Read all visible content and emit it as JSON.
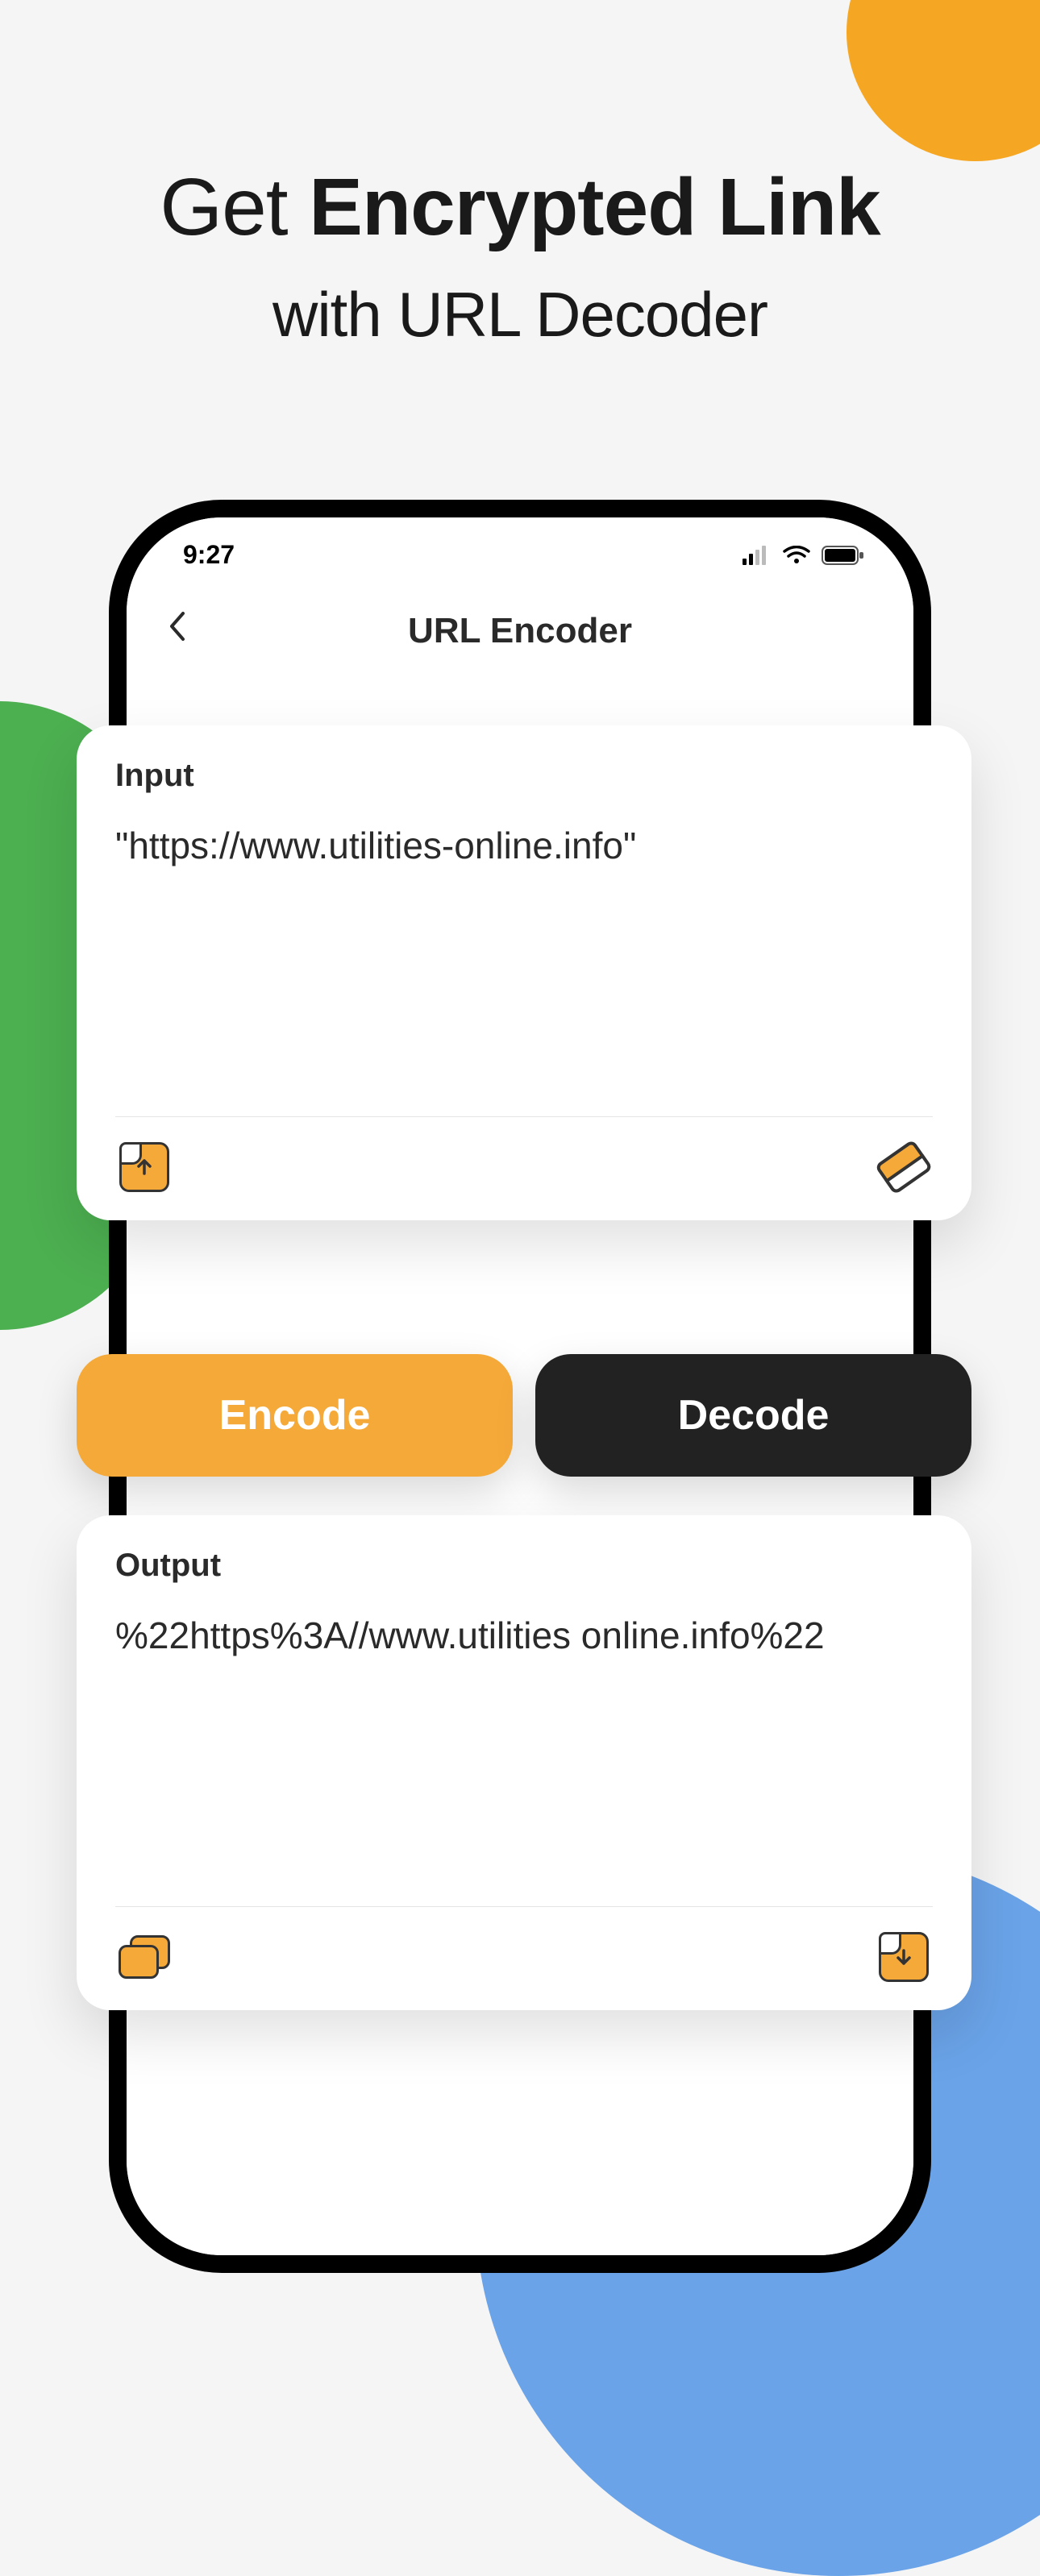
{
  "headline": {
    "prefix": "Get ",
    "bold": "Encrypted Link",
    "sub": "with URL Decoder"
  },
  "status": {
    "time": "9:27"
  },
  "header": {
    "title": "URL Encoder"
  },
  "input": {
    "label": "Input",
    "value": "\"https://www.utilities-online.info\""
  },
  "output": {
    "label": "Output",
    "value": "%22https%3A//www.utilities online.info%22"
  },
  "buttons": {
    "encode": "Encode",
    "decode": "Decode"
  }
}
